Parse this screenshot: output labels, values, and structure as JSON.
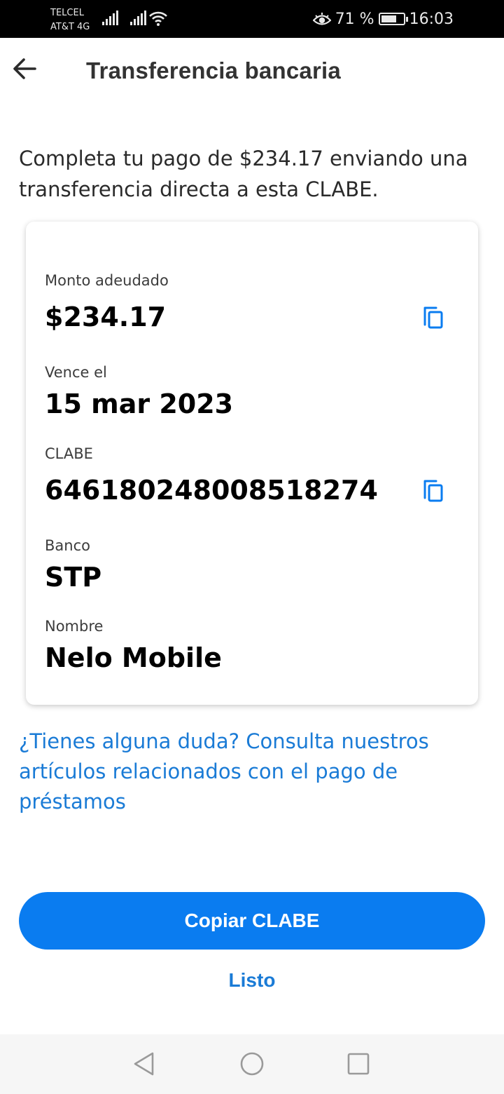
{
  "status_bar": {
    "carrier_line1": "TELCEL",
    "carrier_line2": "AT&T 4G",
    "battery_level": "71 %",
    "battery_fraction": 0.71,
    "time": "16:03",
    "icons": [
      "signal-icon",
      "signal-icon",
      "wifi-icon",
      "eye-icon",
      "battery-icon"
    ]
  },
  "header": {
    "title": "Transferencia bancaria",
    "back_icon": "arrow-left-icon"
  },
  "intro_text": "Completa tu pago de $234.17 enviando una transferencia directa a esta CLABE.",
  "card": {
    "amount": {
      "label": "Monto adeudado",
      "value": "$234.17"
    },
    "due_date": {
      "label": "Vence el",
      "value": "15 mar 2023"
    },
    "clabe": {
      "label": "CLABE",
      "value": "646180248008518274"
    },
    "bank": {
      "label": "Banco",
      "value": "STP"
    },
    "name": {
      "label": "Nombre",
      "value": "Nelo Mobile"
    },
    "copy_icon": "copy-icon"
  },
  "help_link": "¿Tienes alguna duda? Consulta nuestros artículos relacionados con el pago de préstamos",
  "actions": {
    "primary": "Copiar CLABE",
    "secondary": "Listo"
  },
  "nav_bar": {
    "icons": [
      "back-triangle-icon",
      "home-circle-icon",
      "recents-square-icon"
    ]
  },
  "colors": {
    "accent": "#0a7cf0",
    "link": "#1a7bd6",
    "status_bar_bg": "#000000",
    "nav_bar_bg": "#f6f6f6"
  }
}
